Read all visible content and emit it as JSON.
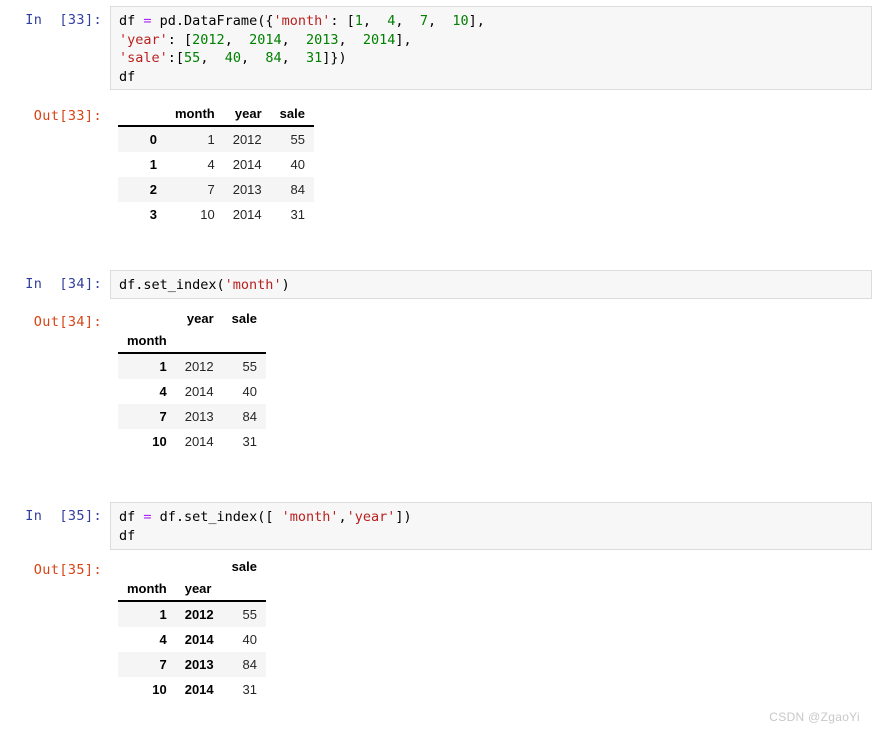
{
  "notebook": {
    "watermark": "CSDN @ZgaoYi",
    "cells": [
      {
        "prompt_in": "In  [33]:",
        "prompt_out": "Out[33]:",
        "code_lines": [
          [
            {
              "t": "plain",
              "v": "df "
            },
            {
              "t": "op",
              "v": "="
            },
            {
              "t": "plain",
              "v": " pd.DataFrame({"
            },
            {
              "t": "str",
              "v": "'month'"
            },
            {
              "t": "plain",
              "v": ": ["
            },
            {
              "t": "num",
              "v": "1"
            },
            {
              "t": "plain",
              "v": ",  "
            },
            {
              "t": "num",
              "v": "4"
            },
            {
              "t": "plain",
              "v": ",  "
            },
            {
              "t": "num",
              "v": "7"
            },
            {
              "t": "plain",
              "v": ",  "
            },
            {
              "t": "num",
              "v": "10"
            },
            {
              "t": "plain",
              "v": "],"
            }
          ],
          [
            {
              "t": "str",
              "v": "'year'"
            },
            {
              "t": "plain",
              "v": ": ["
            },
            {
              "t": "num",
              "v": "2012"
            },
            {
              "t": "plain",
              "v": ",  "
            },
            {
              "t": "num",
              "v": "2014"
            },
            {
              "t": "plain",
              "v": ",  "
            },
            {
              "t": "num",
              "v": "2013"
            },
            {
              "t": "plain",
              "v": ",  "
            },
            {
              "t": "num",
              "v": "2014"
            },
            {
              "t": "plain",
              "v": "],"
            }
          ],
          [
            {
              "t": "str",
              "v": "'sale'"
            },
            {
              "t": "plain",
              "v": ":["
            },
            {
              "t": "num",
              "v": "55"
            },
            {
              "t": "plain",
              "v": ",  "
            },
            {
              "t": "num",
              "v": "40"
            },
            {
              "t": "plain",
              "v": ",  "
            },
            {
              "t": "num",
              "v": "84"
            },
            {
              "t": "plain",
              "v": ",  "
            },
            {
              "t": "num",
              "v": "31"
            },
            {
              "t": "plain",
              "v": "]})"
            }
          ],
          [
            {
              "t": "plain",
              "v": "df"
            }
          ]
        ],
        "table": {
          "index_names": [
            ""
          ],
          "columns": [
            "month",
            "year",
            "sale"
          ],
          "index": [
            "0",
            "1",
            "2",
            "3"
          ],
          "rows": [
            [
              "1",
              "2012",
              "55"
            ],
            [
              "4",
              "2014",
              "40"
            ],
            [
              "7",
              "2013",
              "84"
            ],
            [
              "10",
              "2014",
              "31"
            ]
          ]
        }
      },
      {
        "prompt_in": "In  [34]:",
        "prompt_out": "Out[34]:",
        "code_lines": [
          [
            {
              "t": "plain",
              "v": "df.set_index("
            },
            {
              "t": "str",
              "v": "'month'"
            },
            {
              "t": "plain",
              "v": ")"
            }
          ]
        ],
        "table": {
          "index_names": [
            "month"
          ],
          "columns": [
            "year",
            "sale"
          ],
          "index": [
            "1",
            "4",
            "7",
            "10"
          ],
          "rows": [
            [
              "2012",
              "55"
            ],
            [
              "2014",
              "40"
            ],
            [
              "2013",
              "84"
            ],
            [
              "2014",
              "31"
            ]
          ]
        }
      },
      {
        "prompt_in": "In  [35]:",
        "prompt_out": "Out[35]:",
        "code_lines": [
          [
            {
              "t": "plain",
              "v": "df "
            },
            {
              "t": "op",
              "v": "="
            },
            {
              "t": "plain",
              "v": " df.set_index(["
            },
            {
              "t": "str",
              "v": " 'month'"
            },
            {
              "t": "plain",
              "v": ","
            },
            {
              "t": "str",
              "v": "'year'"
            },
            {
              "t": "plain",
              "v": "])"
            }
          ],
          [
            {
              "t": "plain",
              "v": "df"
            }
          ]
        ],
        "table": {
          "index_names": [
            "month",
            "year"
          ],
          "columns": [
            "sale"
          ],
          "index": [
            [
              "1",
              "2012"
            ],
            [
              "4",
              "2014"
            ],
            [
              "7",
              "2013"
            ],
            [
              "10",
              "2014"
            ]
          ],
          "rows": [
            [
              "55"
            ],
            [
              "40"
            ],
            [
              "84"
            ],
            [
              "31"
            ]
          ]
        }
      }
    ]
  }
}
